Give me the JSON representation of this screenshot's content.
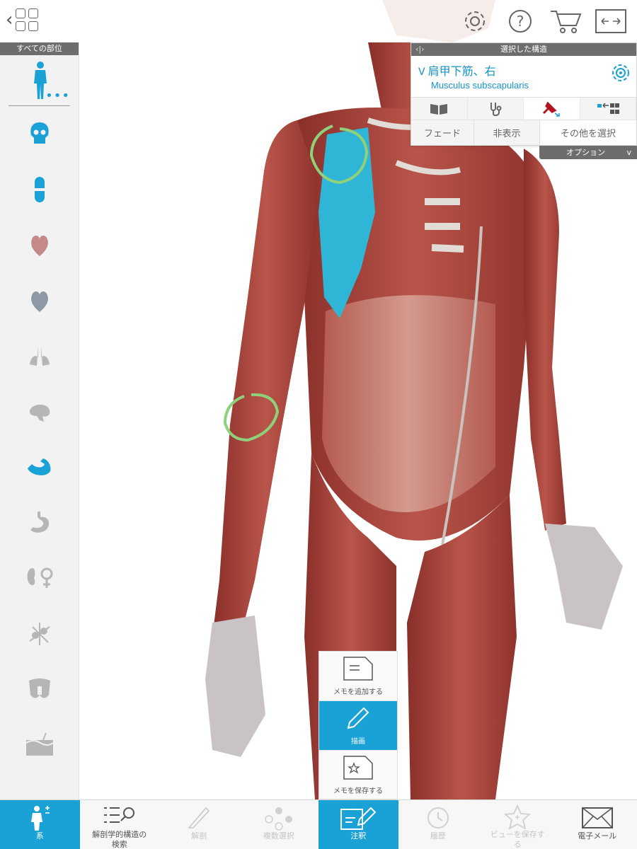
{
  "colors": {
    "accent": "#1aa1d6",
    "muscle": "#a8413a",
    "selected_muscle": "#2fb6d6",
    "annotation_stroke": "#8fd07a",
    "header_gray": "#6d6d6d"
  },
  "sidebar": {
    "header": "すべての部位",
    "body_button_dots": "•••",
    "items": [
      {
        "icon": "skull-icon",
        "active": false
      },
      {
        "icon": "joint-icon",
        "active": false
      },
      {
        "icon": "heart-icon",
        "active": false
      },
      {
        "icon": "heart-vessels-icon",
        "active": false
      },
      {
        "icon": "lungs-icon",
        "active": false
      },
      {
        "icon": "brain-icon",
        "active": false
      },
      {
        "icon": "muscle-arm-icon",
        "active": true
      },
      {
        "icon": "stomach-icon",
        "active": false
      },
      {
        "icon": "kidney-female-icon",
        "active": false
      },
      {
        "icon": "lymph-node-icon",
        "active": false
      },
      {
        "icon": "thyroid-icon",
        "active": false
      },
      {
        "icon": "skin-icon",
        "active": false
      }
    ]
  },
  "selected_panel": {
    "header": "選択した構造",
    "collapse_icon": "‹|›",
    "title": "肩甲下筋、右",
    "title_chevron": "V",
    "latin_name": "Musculus subscapularis",
    "actions": {
      "fade": "フェード",
      "hide": "非表示",
      "select_more": "その他を選択"
    },
    "options_tab": "オプション",
    "options_chevron": "v"
  },
  "annotation_menu": {
    "items": [
      {
        "label": "メモを追加する",
        "icon": "note-add-icon",
        "active": false
      },
      {
        "label": "描画",
        "icon": "pencil-icon",
        "active": true
      },
      {
        "label": "メモを保存する",
        "icon": "note-save-icon",
        "active": false
      }
    ]
  },
  "tabbar": {
    "tabs": [
      {
        "label": "系",
        "icon": "systems-icon",
        "state": "active"
      },
      {
        "label": "解剖学的構造の\n検索",
        "icon": "search-list-icon",
        "state": "normal"
      },
      {
        "label": "解剖",
        "icon": "scalpel-icon",
        "state": "disabled"
      },
      {
        "label": "複数選択",
        "icon": "multi-select-icon",
        "state": "disabled"
      },
      {
        "label": "注釈",
        "icon": "annotate-icon",
        "state": "active"
      },
      {
        "label": "履歴",
        "icon": "history-icon",
        "state": "disabled"
      },
      {
        "label": "ビューを保存す\nる",
        "icon": "save-view-icon",
        "state": "disabled"
      },
      {
        "label": "電子メール",
        "icon": "mail-icon",
        "state": "normal"
      }
    ]
  }
}
